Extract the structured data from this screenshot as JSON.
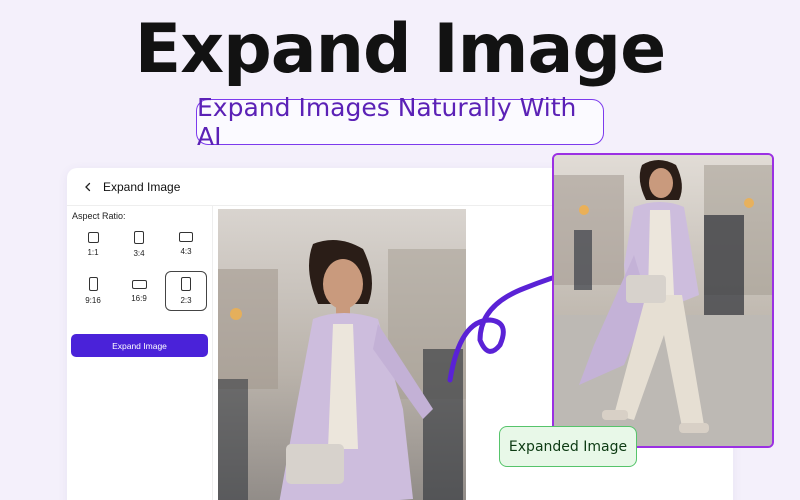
{
  "hero": {
    "title": "Expand Image",
    "subtitle": "Expand Images Naturally With AI"
  },
  "app": {
    "header_title": "Expand Image",
    "aspect_label": "Aspect Ratio:",
    "ratios": [
      {
        "label": "1:1",
        "selected": false
      },
      {
        "label": "3:4",
        "selected": false
      },
      {
        "label": "4:3",
        "selected": false
      },
      {
        "label": "9:16",
        "selected": false
      },
      {
        "label": "16:9",
        "selected": false
      },
      {
        "label": "2:3",
        "selected": true
      }
    ],
    "expand_button": "Expand Image"
  },
  "result_badge": "Expanded Image",
  "colors": {
    "accent": "#4a22d9",
    "subtitle_border": "#7c3aed",
    "result_border": "#9b30e3",
    "badge_border": "#56c46b",
    "arrow": "#5a22d6"
  }
}
